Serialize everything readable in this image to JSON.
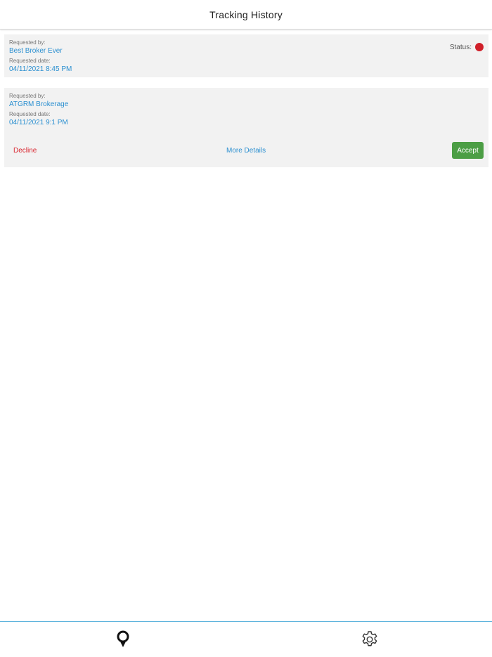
{
  "header": {
    "title": "Tracking History"
  },
  "requests": [
    {
      "requested_by_label": "Requested by:",
      "requested_by": "Best Broker Ever",
      "requested_date_label": "Requested date:",
      "requested_date": "04/11/2021 8:45 PM",
      "status_label": "Status:",
      "status_color": "#d0202a"
    },
    {
      "requested_by_label": "Requested by:",
      "requested_by": "ATGRM Brokerage",
      "requested_date_label": "Requested date:",
      "requested_date": "04/11/2021 9:1 PM",
      "decline_label": "Decline",
      "more_details_label": "More Details",
      "accept_label": "Accept"
    }
  ],
  "tabbar": {
    "tabs": [
      {
        "icon": "location-pin-icon"
      },
      {
        "icon": "gear-icon"
      }
    ]
  },
  "colors": {
    "link": "#2a8fd0",
    "decline": "#d9232d",
    "accept": "#4c9e45",
    "tab_border": "#5fb4dd"
  }
}
